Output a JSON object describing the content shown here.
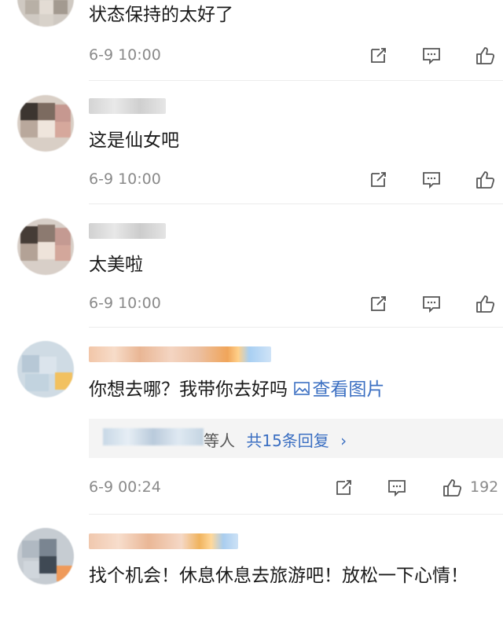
{
  "comments": [
    {
      "text": "状态保持的太好了",
      "time": "6-9 10:00"
    },
    {
      "text": "这是仙女吧",
      "time": "6-9 10:00"
    },
    {
      "text": "太美啦",
      "time": "6-9 10:00"
    },
    {
      "text": "你想去哪？我带你去好吗",
      "view_image_link": "查看图片",
      "reply_summary_suffix": "等人",
      "reply_count_text": "共15条回复",
      "reply_chevron": "›",
      "time": "6-9 00:24",
      "likes": "192"
    },
    {
      "text": "找个机会！休息休息去旅游吧！放松一下心情！"
    }
  ],
  "icons": {
    "share": "share-icon",
    "comment": "comment-icon",
    "like": "thumbs-up-icon",
    "image": "image-icon"
  },
  "colors": {
    "link": "#3b6fc2",
    "meta": "#8a8a8a",
    "text": "#1a1a1a",
    "reply_bg": "#f4f4f4"
  }
}
